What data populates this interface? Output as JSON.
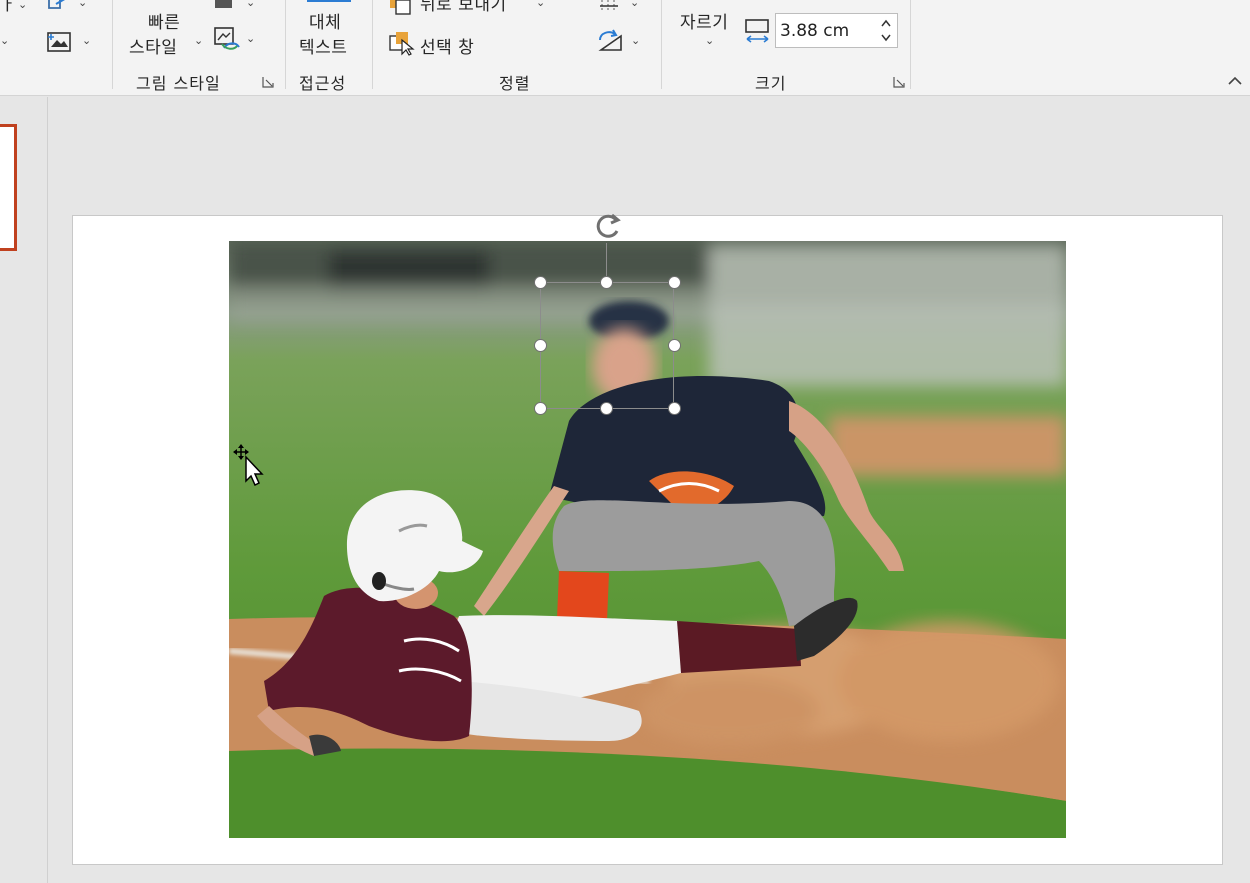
{
  "ribbon": {
    "quick_styles": {
      "line1": "빠른",
      "line2": "스타일"
    },
    "group_picture_styles": "그림 스타일",
    "alt_text": {
      "line1": "대체",
      "line2": "텍스트"
    },
    "group_accessibility": "접근성",
    "send_backward": "뒤로 보내기",
    "selection_pane": "선택 창",
    "group_arrange": "정렬",
    "crop": "자르기",
    "height_value": "3.88 cm",
    "group_size": "크기"
  },
  "colors": {
    "ribbon_bg": "#f3f3f3",
    "accent_orange": "#e8a33a",
    "accent_blue": "#2b7cd3",
    "thumb_border": "#c0411f"
  }
}
